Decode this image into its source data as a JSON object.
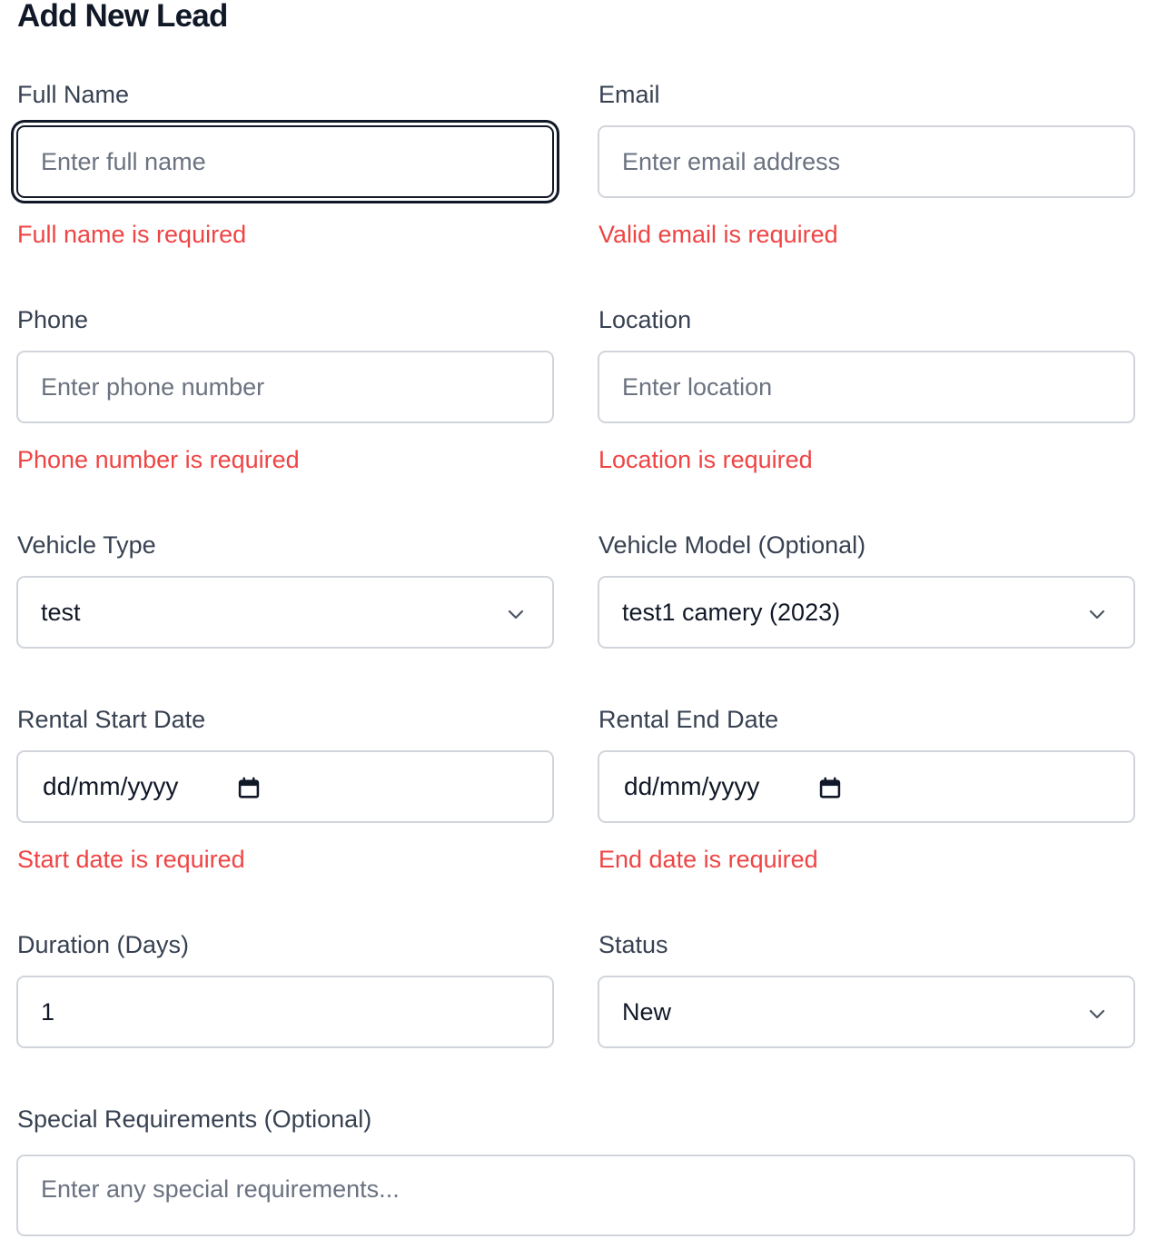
{
  "page": {
    "title": "Add New Lead"
  },
  "form": {
    "full_name": {
      "label": "Full Name",
      "placeholder": "Enter full name",
      "error": "Full name is required"
    },
    "email": {
      "label": "Email",
      "placeholder": "Enter email address",
      "error": "Valid email is required"
    },
    "phone": {
      "label": "Phone",
      "placeholder": "Enter phone number",
      "error": "Phone number is required"
    },
    "location": {
      "label": "Location",
      "placeholder": "Enter location",
      "error": "Location is required"
    },
    "vehicle_type": {
      "label": "Vehicle Type",
      "value": "test"
    },
    "vehicle_model": {
      "label": "Vehicle Model (Optional)",
      "value": "test1 camery (2023)"
    },
    "rental_start_date": {
      "label": "Rental Start Date",
      "value": "dd/mm/yyyy",
      "error": "Start date is required"
    },
    "rental_end_date": {
      "label": "Rental End Date",
      "value": "dd/mm/yyyy",
      "error": "End date is required"
    },
    "duration": {
      "label": "Duration (Days)",
      "value": "1"
    },
    "status": {
      "label": "Status",
      "value": "New"
    },
    "special_requirements": {
      "label": "Special Requirements (Optional)",
      "placeholder": "Enter any special requirements..."
    }
  },
  "icons": {
    "dropdown": "chevron-down-icon",
    "date": "calendar-icon"
  },
  "colors": {
    "error": "#ef4444",
    "label": "#374151",
    "border": "#d1d5db",
    "focus_ring": "#111827",
    "placeholder": "#6b7280"
  }
}
